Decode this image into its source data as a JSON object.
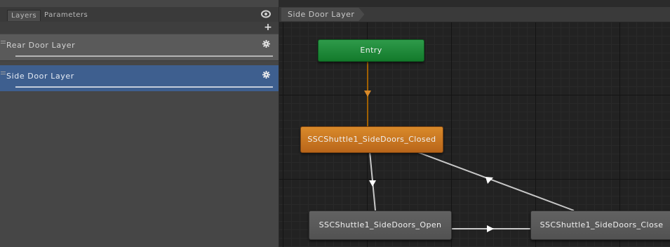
{
  "left_panel": {
    "tabs": [
      {
        "label": "Layers",
        "active": true
      },
      {
        "label": "Parameters",
        "active": false
      }
    ],
    "eye_icon": "eye-icon",
    "add_icon": "+",
    "layers": [
      {
        "name": "Rear Door Layer",
        "selected": false
      },
      {
        "name": "Side Door Layer",
        "selected": true
      }
    ]
  },
  "graph": {
    "breadcrumb": "Side Door Layer",
    "states": {
      "entry": "Entry",
      "closed": "SSCShuttle1_SideDoors_Closed",
      "open": "SSCShuttle1_SideDoors_Open",
      "close": "SSCShuttle1_SideDoors_Close"
    }
  },
  "colors": {
    "entry_node": "#1f8a3a",
    "default_state": "#c87422",
    "state": "#5a5a5a",
    "selected_layer": "#3e5f8f",
    "entry_transition": "#a06000",
    "transition": "#d0d0d0"
  }
}
